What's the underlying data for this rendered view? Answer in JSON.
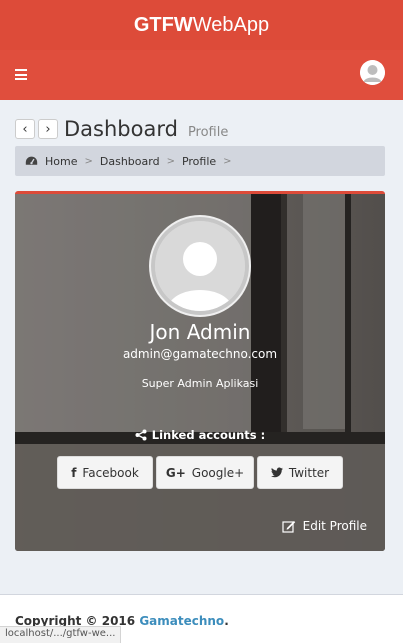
{
  "app": {
    "brand_bold": "GTFW",
    "brand_rest": "WebApp"
  },
  "navbar": {
    "menu_icon": "hamburger-icon",
    "user_icon": "user-avatar-icon"
  },
  "page": {
    "title": "Dashboard",
    "subtitle": "Profile",
    "back_icon": "chevron-left-icon",
    "forward_icon": "chevron-right-icon"
  },
  "breadcrumb": {
    "icon": "dashboard-icon",
    "items": [
      "Home",
      "Dashboard",
      "Profile"
    ],
    "separator": ">"
  },
  "profile": {
    "name": "Jon Admin",
    "email": "admin@gamatechno.com",
    "role": "Super Admin Aplikasi",
    "linked_label": "Linked accounts :",
    "accent": "#dd4b39"
  },
  "social": {
    "facebook": "Facebook",
    "google": "Google+",
    "twitter": "Twitter"
  },
  "edit_label": "Edit Profile",
  "footer": {
    "copyright": "Copyright © 2016",
    "company": "Gamatechno",
    "suffix": "."
  },
  "status_bar": {
    "url": "localhost/.../gtfw-we..."
  }
}
